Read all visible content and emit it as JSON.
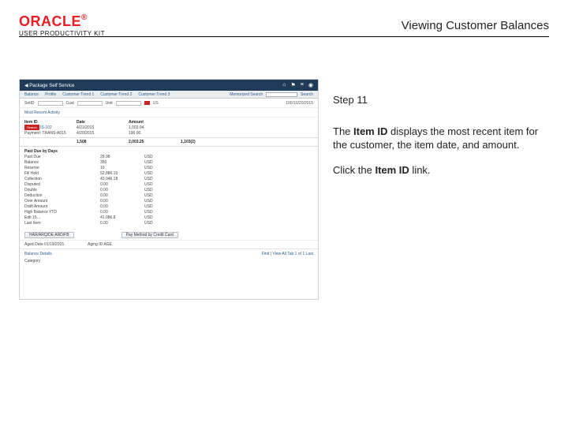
{
  "brand": {
    "name": "ORACLE",
    "reg": "®",
    "subline": "USER PRODUCTIVITY KIT"
  },
  "page_title": "Viewing Customer Balances",
  "instructions": {
    "step_label": "Step 11",
    "para1_pre": "The ",
    "para1_bold": "Item ID",
    "para1_post": " displays the most recent item for the customer, the item date, and amount.",
    "para2_pre": "Click the ",
    "para2_bold": "Item ID",
    "para2_post": " link."
  },
  "mini": {
    "topbar_title": "◀  Package Self Service",
    "topbar_icons": {
      "home": "⌂",
      "flag": "⚑",
      "menu": "≡",
      "alert": "◉"
    },
    "tabs": [
      "Balance",
      "Profile",
      "Customer Trend 1",
      "Customer Trend 2",
      "Customer Trend 3"
    ],
    "tabs_right": {
      "memo": "Memorized Search",
      "search_btn": "Search"
    },
    "row1": {
      "set": "SetID",
      "cust": "Cust",
      "unit": "Unit",
      "us": "US",
      "date": "100/10/20/2015"
    },
    "section_title": "Most Recent Activity",
    "item_headers": [
      "Item ID",
      "Date",
      "Amount",
      ""
    ],
    "items": [
      {
        "tag": "Search",
        "id": "IS-102",
        "date": "4/21/2015",
        "amount": "1,003.04"
      },
      {
        "tag": "",
        "id": "Payment: TRANS-A015",
        "date": "4/20/2015",
        "amount": "190.00"
      }
    ],
    "totals": [
      "",
      "1,508",
      "2,003.25",
      "1,103(2)"
    ],
    "balance_headers": [
      "Past Due by Days",
      "",
      ""
    ],
    "balance_rows": [
      [
        "Past Due",
        "29.98",
        "USD"
      ],
      [
        "Balance",
        "350",
        "USD"
      ],
      [
        "Reserve",
        "10",
        "USD"
      ],
      [
        "Fill Held",
        "52,886.15",
        "USD"
      ],
      [
        "Collection",
        "43,046.18",
        "USD"
      ],
      [
        "Disputed",
        "0.00",
        "USD"
      ],
      [
        "Double",
        "0.00",
        "USD"
      ],
      [
        "Deduction",
        "0.00",
        "USD"
      ],
      [
        "Over Amount",
        "0.00",
        "USD"
      ],
      [
        "Draft Amount",
        "0.00",
        "USD"
      ],
      [
        "High Balance YTD",
        "0.00",
        "USD"
      ],
      [
        "Edit 15…",
        "41,086.8",
        "USD"
      ],
      [
        "Last Item",
        "0.00",
        "USD"
      ]
    ],
    "actions": {
      "btn1": "HAR/ARQ/DE ARD/FB",
      "btn2": "Pay Method by Credit Card"
    },
    "aging": {
      "date_label": "Aged Date 01/19/2015",
      "id_label": "Aging ID  AGE"
    },
    "footer": {
      "left": "Balance Details",
      "right": "Find | View All   Tab  1 of 1   Last",
      "cat": "Category"
    }
  }
}
